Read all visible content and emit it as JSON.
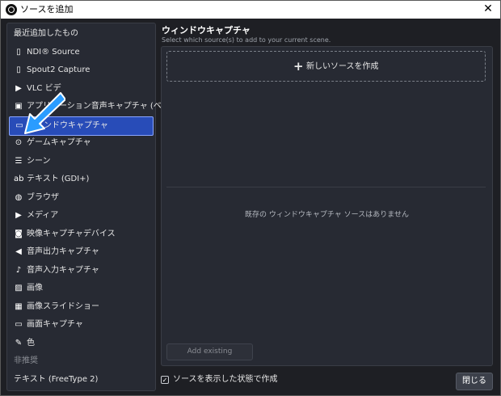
{
  "window": {
    "title": "ソースを追加",
    "close": "✕"
  },
  "sidebar": {
    "items": [
      {
        "label": "最近追加したもの",
        "icon": "",
        "kind": "plain"
      },
      {
        "label": "NDI® Source",
        "icon": "document-icon"
      },
      {
        "label": "Spout2 Capture",
        "icon": "document-icon"
      },
      {
        "label": "VLC ビデ",
        "icon": "play-icon"
      },
      {
        "label": "アプリケーション音声キャプチャ (ベータ版)",
        "icon": "speaker-window-icon"
      },
      {
        "label": "ウィンドウキャプチャ",
        "icon": "window-icon",
        "selected": true
      },
      {
        "label": "ゲームキャプチャ",
        "icon": "gamepad-icon"
      },
      {
        "label": "シーン",
        "icon": "list-icon"
      },
      {
        "label": "テキスト (GDI+)",
        "icon": "text-icon"
      },
      {
        "label": "ブラウザ",
        "icon": "globe-icon"
      },
      {
        "label": "メディア",
        "icon": "play-icon"
      },
      {
        "label": "映像キャプチャデバイス",
        "icon": "camera-icon"
      },
      {
        "label": "音声出力キャプチャ",
        "icon": "speaker-icon"
      },
      {
        "label": "音声入力キャプチャ",
        "icon": "microphone-icon"
      },
      {
        "label": "画像",
        "icon": "image-icon"
      },
      {
        "label": "画像スライドショー",
        "icon": "slideshow-icon"
      },
      {
        "label": "画面キャプチャ",
        "icon": "monitor-icon"
      },
      {
        "label": "色",
        "icon": "brush-icon"
      },
      {
        "label": "非推奨",
        "icon": "",
        "kind": "muted"
      },
      {
        "label": "テキスト (FreeType 2)",
        "icon": "",
        "kind": "plain"
      }
    ]
  },
  "main": {
    "heading": "ウィンドウキャプチャ",
    "subheading": "Select which source(s) to add to your current scene.",
    "new_source": {
      "plus": "+",
      "label": "新しいソースを作成"
    },
    "empty_message": "既存の ウィンドウキャプチャ ソースはありません",
    "add_existing": "Add existing"
  },
  "footer": {
    "visible_label": "ソースを表示した状態で作成",
    "visible_checked": "✓",
    "close_label": "閉じる"
  },
  "colors": {
    "selected_bg": "#284cb8",
    "arrow": "#2a9cff"
  }
}
